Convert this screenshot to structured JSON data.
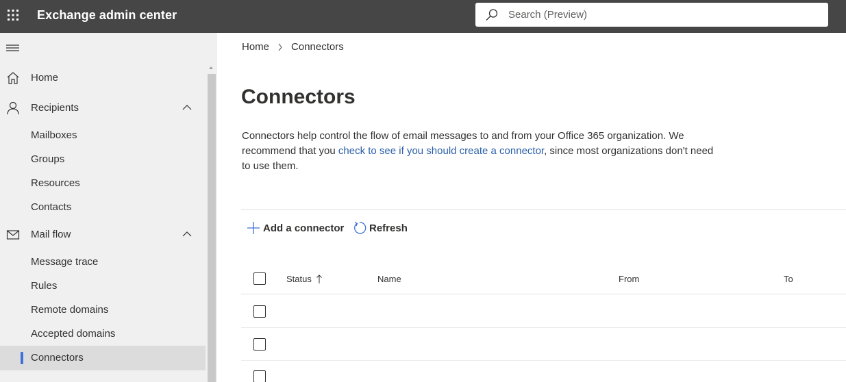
{
  "header": {
    "app_title": "Exchange admin center",
    "search_placeholder": "Search (Preview)",
    "search_value": ""
  },
  "sidebar": {
    "items": [
      {
        "label": "Home",
        "icon": "home-icon"
      },
      {
        "label": "Recipients",
        "icon": "person-icon",
        "expanded": true
      },
      {
        "label": "Mailboxes"
      },
      {
        "label": "Groups"
      },
      {
        "label": "Resources"
      },
      {
        "label": "Contacts"
      },
      {
        "label": "Mail flow",
        "icon": "mail-icon",
        "expanded": true
      },
      {
        "label": "Message trace"
      },
      {
        "label": "Rules"
      },
      {
        "label": "Remote domains"
      },
      {
        "label": "Accepted domains"
      },
      {
        "label": "Connectors",
        "selected": true
      }
    ]
  },
  "breadcrumb": {
    "home": "Home",
    "current": "Connectors"
  },
  "main": {
    "title": "Connectors",
    "description_before": "Connectors help control the flow of email messages to and from your Office 365 organization. We recommend that you ",
    "description_link": "check to see if you should create a connector",
    "description_after": ", since most organizations don't need to use them.",
    "commands": {
      "add": "Add a connector",
      "refresh": "Refresh"
    },
    "table": {
      "columns": [
        "Status",
        "Name",
        "From",
        "To"
      ],
      "sort_column": "Status",
      "sort_direction": "ascending",
      "rows": []
    }
  },
  "colors": {
    "topbar": "#464646",
    "sidebar": "#f0f0f0",
    "accent": "#3f72d8",
    "link": "#2a5ea7"
  }
}
